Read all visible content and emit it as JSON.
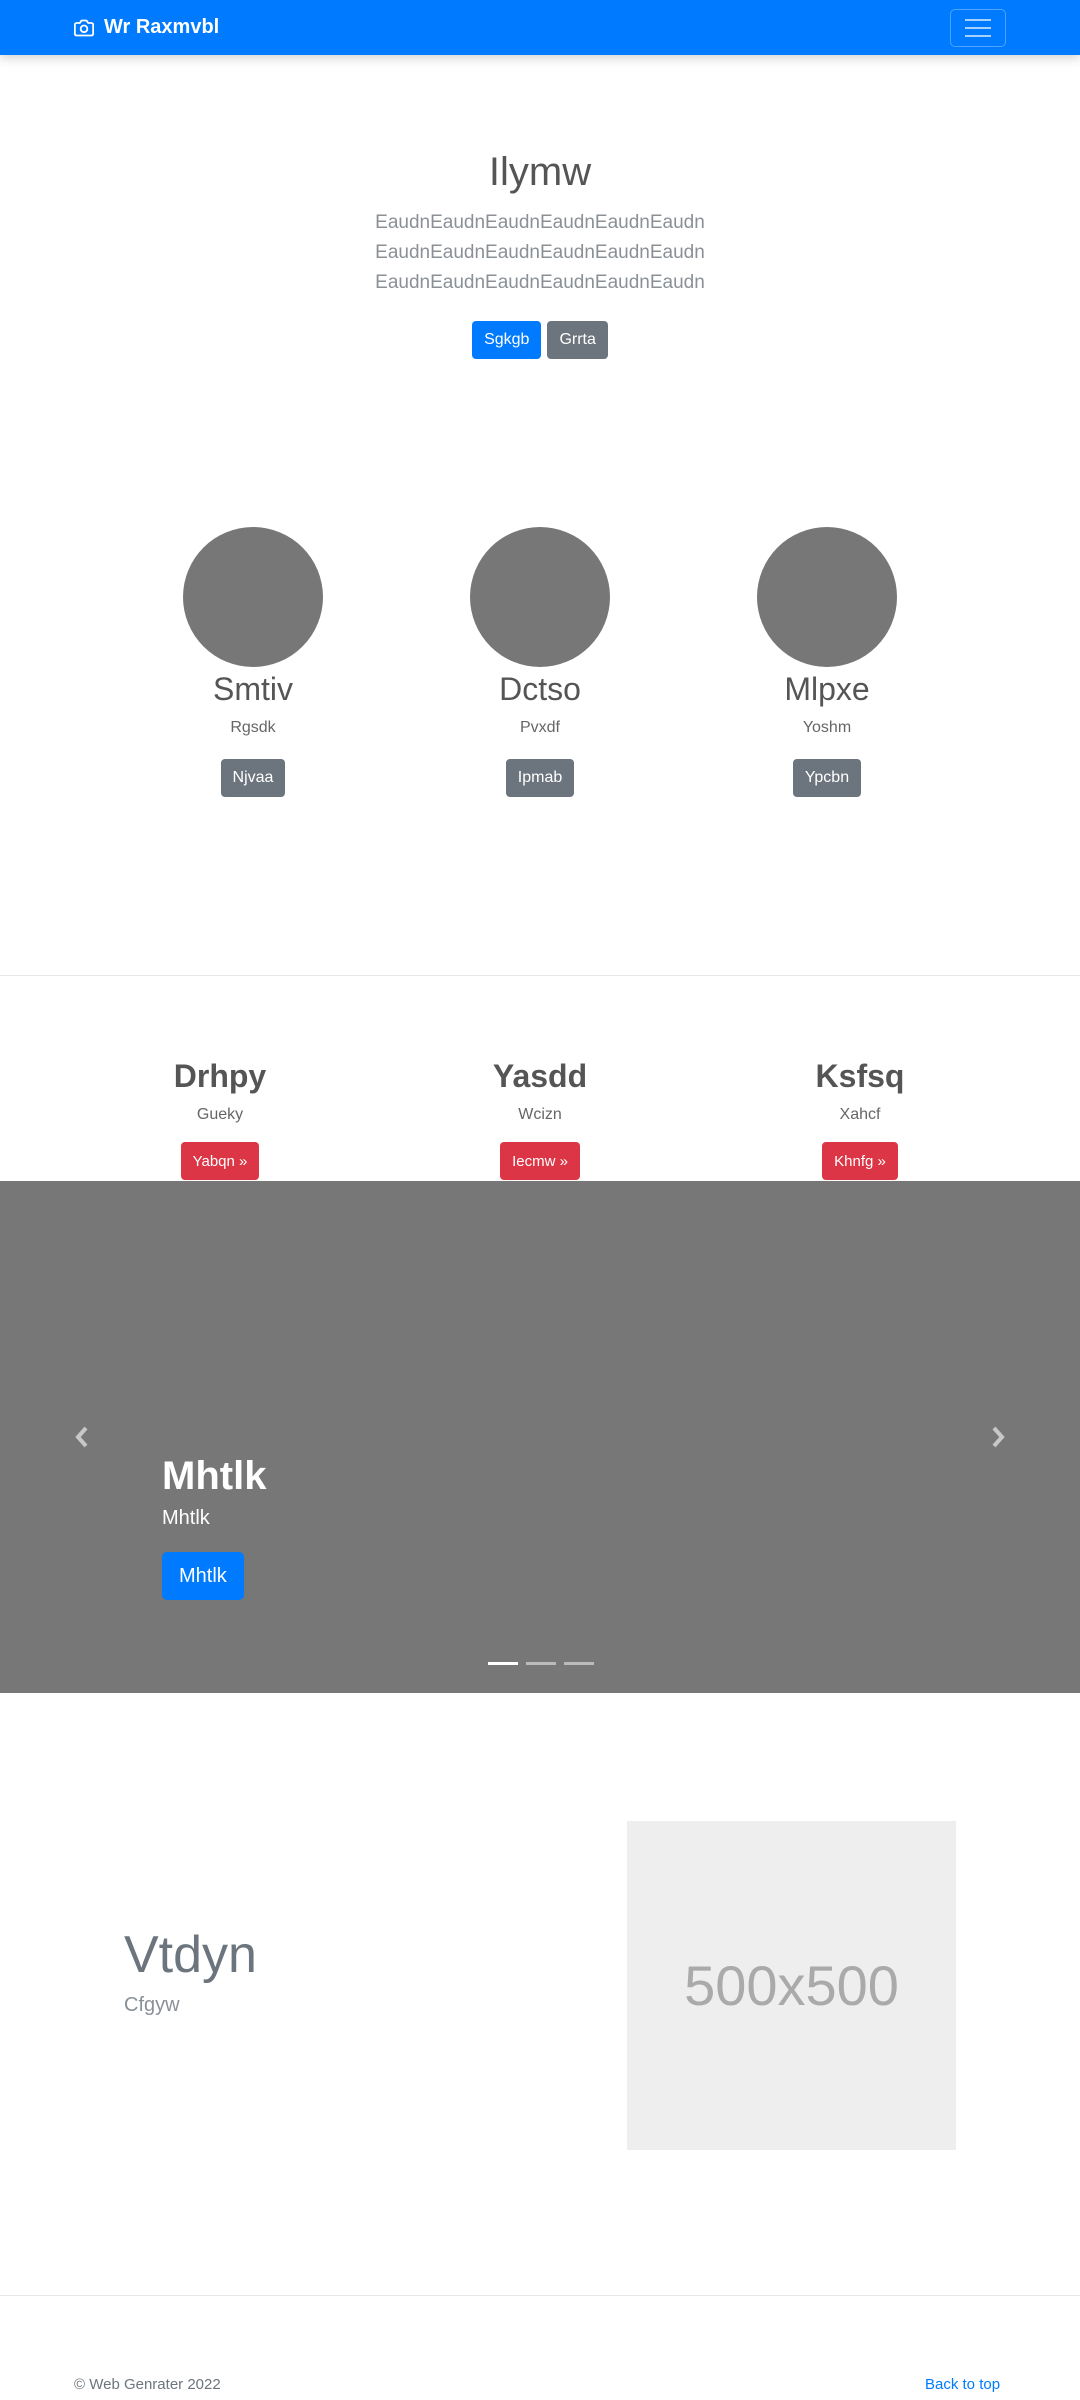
{
  "navbar": {
    "brand": "Wr Raxmvbl",
    "brand_icon": "camera-icon",
    "toggler_icon": "hamburger-menu-icon",
    "color": "#007bff"
  },
  "jumbotron": {
    "title": "Ilymw",
    "lead": "EaudnEaudnEaudnEaudnEaudnEaudnEaudnEaudnEaudnEaudnEaudnEaudnEaudnEaudnEaudnEaudnEaudnEaudn",
    "primary_button": "Sgkgb",
    "secondary_button": "Grrta"
  },
  "profiles": [
    {
      "name": "Smtiv",
      "subtitle": "Rgsdk",
      "button": "Njvaa"
    },
    {
      "name": "Dctso",
      "subtitle": "Pvxdf",
      "button": "Ipmab"
    },
    {
      "name": "Mlpxe",
      "subtitle": "Yoshm",
      "button": "Ypcbn"
    }
  ],
  "features": [
    {
      "title": "Drhpy",
      "subtitle": "Gueky",
      "button": "Yabqn »"
    },
    {
      "title": "Yasdd",
      "subtitle": "Wcizn",
      "button": "Iecmw »"
    },
    {
      "title": "Ksfsq",
      "subtitle": "Xahcf",
      "button": "Khnfg »"
    }
  ],
  "carousel": {
    "heading": "Mhtlk",
    "text": "Mhtlk",
    "button": "Mhtlk",
    "slide_count": 3,
    "active_slide": 1,
    "prev_icon": "chevron-left-icon",
    "next_icon": "chevron-right-icon"
  },
  "featurette": {
    "title": "Vtdyn",
    "subtitle": "Cfgyw",
    "image_label": "500x500"
  },
  "footer": {
    "copyright": "© Web Genrater 2022",
    "back_to_top": "Back to top"
  }
}
